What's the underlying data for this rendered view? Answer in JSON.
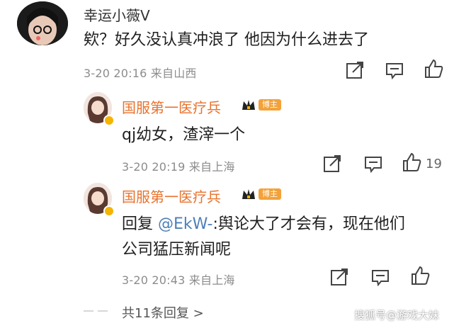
{
  "comment": {
    "author": "幸运小薇V",
    "text": "欸？好久没认真冲浪了 他因为什么进去了",
    "meta": "3-20 20:16 来自山西"
  },
  "replies": [
    {
      "author": "国服第一医疗兵",
      "badge": "博主",
      "text": "qj幼女，渣滓一个",
      "meta": "3-20 20:19 来自上海",
      "like_count": "19"
    },
    {
      "author": "国服第一医疗兵",
      "badge": "博主",
      "reply_prefix": "回复 ",
      "mention": "@EkW-",
      "text_line1": ":舆论大了才会有，现在他们",
      "text_line2": "公司猛压新闻呢",
      "meta": "3-20 20:43 来自上海"
    }
  ],
  "more_replies": "共11条回复 >",
  "watermark": "搜狐号@游戏大妹",
  "icons": {
    "share": "share-icon",
    "comment": "comment-icon",
    "like": "thumbs-up-icon"
  }
}
